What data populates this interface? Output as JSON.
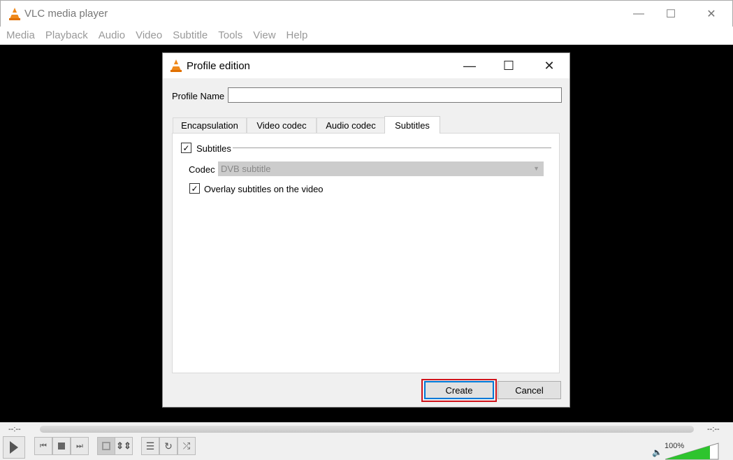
{
  "window": {
    "title": "VLC media player"
  },
  "menu": [
    "Media",
    "Playback",
    "Audio",
    "Video",
    "Subtitle",
    "Tools",
    "View",
    "Help"
  ],
  "dialog": {
    "title": "Profile edition",
    "profile_name_label": "Profile Name",
    "profile_name_value": "",
    "tabs": [
      {
        "label": "Encapsulation"
      },
      {
        "label": "Video codec"
      },
      {
        "label": "Audio codec"
      },
      {
        "label": "Subtitles",
        "active": true
      }
    ],
    "subtitles": {
      "enabled_label": "Subtitles",
      "enabled": true,
      "codec_label": "Codec",
      "codec_value": "DVB subtitle",
      "overlay_label": "Overlay subtitles on the video",
      "overlay": true
    },
    "create_label": "Create",
    "cancel_label": "Cancel"
  },
  "controls": {
    "elapsed": "--:--",
    "remaining": "--:--",
    "volume_label": "100%",
    "volume_percent": 100
  },
  "colors": {
    "highlight": "#d0131b",
    "focus": "#0078d7",
    "volume": "#2ec42e"
  }
}
